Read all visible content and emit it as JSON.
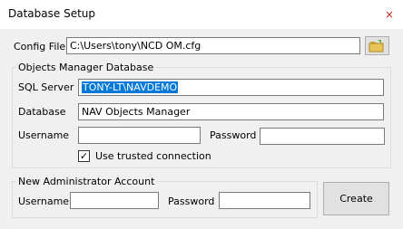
{
  "window": {
    "title": "Database Setup",
    "close_glyph": "×",
    "close_color": "#c42b1c"
  },
  "config": {
    "label": "Config File",
    "value": "C:\\Users\\tony\\NCD OM.cfg",
    "browse_icon": "folder-open-icon"
  },
  "objects_manager": {
    "legend": "Objects Manager Database",
    "sql_server_label": "SQL Server",
    "sql_server_value": "TONY-LT\\NAVDEMO",
    "database_label": "Database",
    "database_value": "NAV Objects Manager",
    "username_label": "Username",
    "username_value": "",
    "password_label": "Password",
    "password_value": "",
    "trusted_checked": true,
    "trusted_label": "Use trusted connection"
  },
  "admin": {
    "legend": "New Administrator Account",
    "username_label": "Username",
    "username_value": "",
    "password_label": "Password",
    "password_value": ""
  },
  "create_button_label": "Create",
  "colors": {
    "selection": "#0078d7",
    "window_bg": "#f0f0f0"
  }
}
